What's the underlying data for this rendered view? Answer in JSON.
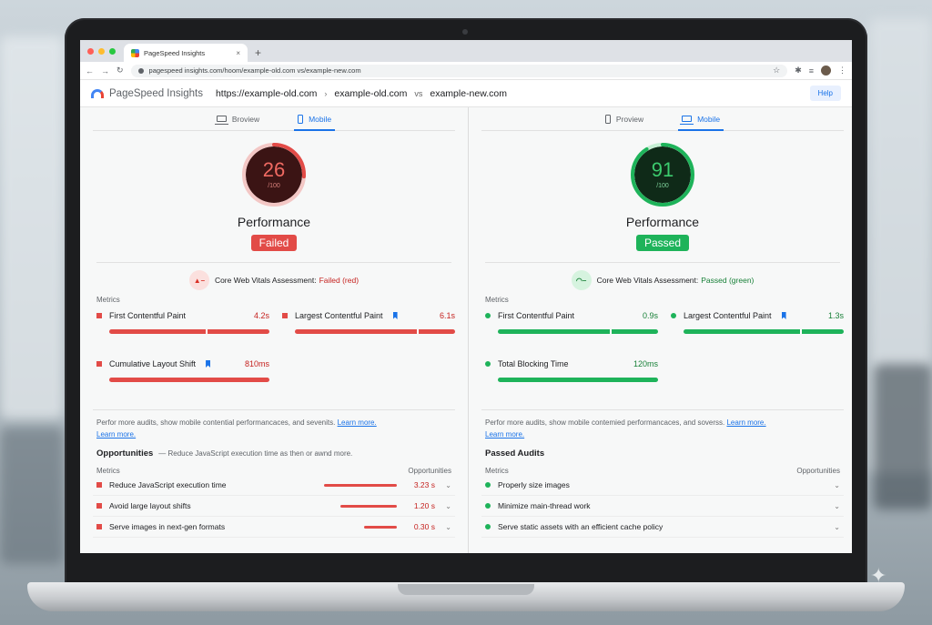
{
  "colors": {
    "fail": "#e24b47",
    "pass": "#1eb35a",
    "link": "#1a73e8",
    "fail_dark": "#3b1414",
    "pass_dark": "#0f2a18"
  },
  "browser": {
    "tab_title": "PageSpeed Insights",
    "url": "pagespeed insights.com/hoom/example-old.com vs/example-new.com"
  },
  "header": {
    "app_name": "PageSpeed Insights",
    "url_1": "https://example-old.com",
    "url_2": "example-old.com",
    "vs": "vs",
    "url_3": "example-new.com",
    "help_label": "Help"
  },
  "left": {
    "tabs": [
      {
        "label": "Broview",
        "icon": "desktop-icon"
      },
      {
        "label": "Mobile",
        "icon": "mobile-icon"
      }
    ],
    "score": 26,
    "score_max": "/100",
    "score_fraction": 0.26,
    "performance_label": "Performance",
    "status": "Failed",
    "cwv_icon_text": "▲–",
    "cwv_label": "Core Web Vitals Assessment:",
    "cwv_result": "Failed (red)",
    "metrics_label": "Metrics",
    "metrics": [
      {
        "name": "First Contentful Paint",
        "value": "4.2s",
        "flag": false
      },
      {
        "name": "Largest Contentful Paint",
        "value": "6.1s",
        "flag": true
      },
      {
        "name": "Cumulative Layout Shift",
        "value": "810ms",
        "flag": true
      }
    ],
    "note": "Perfor more audits, show mobile contential performancaces, and sevenits.",
    "note_link": "Learn more.",
    "note_link2": "Learn more.",
    "section_title": "Opportunities",
    "section_sub": "—  Reduce JavaScript execution time as then or awnd more.",
    "col_left": "Metrics",
    "col_right": "Opportunities",
    "audits": [
      {
        "name": "Reduce JavaScript execution time",
        "value": "3.23 s",
        "bar": 0.8
      },
      {
        "name": "Avoid large layout shifts",
        "value": "1.20 s",
        "bar": 0.6
      },
      {
        "name": "Serve images in next-gen formats",
        "value": "0.30 s",
        "bar": 0.35
      }
    ]
  },
  "right": {
    "tabs": [
      {
        "label": "Proview",
        "icon": "mobile-icon"
      },
      {
        "label": "Mobile",
        "icon": "desktop-icon"
      }
    ],
    "score": 91,
    "score_max": "/100",
    "score_fraction": 0.91,
    "performance_label": "Performance",
    "status": "Passed",
    "cwv_icon_text": "◠–",
    "cwv_label": "Core Web Vitals Assessment:",
    "cwv_result": "Passed (green)",
    "metrics_label": "Metrics",
    "metrics": [
      {
        "name": "First Contentful Paint",
        "value": "0.9s",
        "flag": false
      },
      {
        "name": "Largest Contentful Paint",
        "value": "1.3s",
        "flag": true
      },
      {
        "name": "Total Blocking Time",
        "value": "120ms",
        "flag": false
      }
    ],
    "note": "Perfor more audits, show mobile contemied performancaces, and soverss.",
    "note_link": "Learn more.",
    "note_link2": "Learn more.",
    "section_title": "Passed Audits",
    "col_left": "Metrics",
    "col_right": "Opportunities",
    "audits": [
      {
        "name": "Properly size images"
      },
      {
        "name": "Minimize main-thread work"
      },
      {
        "name": "Serve static assets with an efficient cache policy"
      }
    ]
  }
}
